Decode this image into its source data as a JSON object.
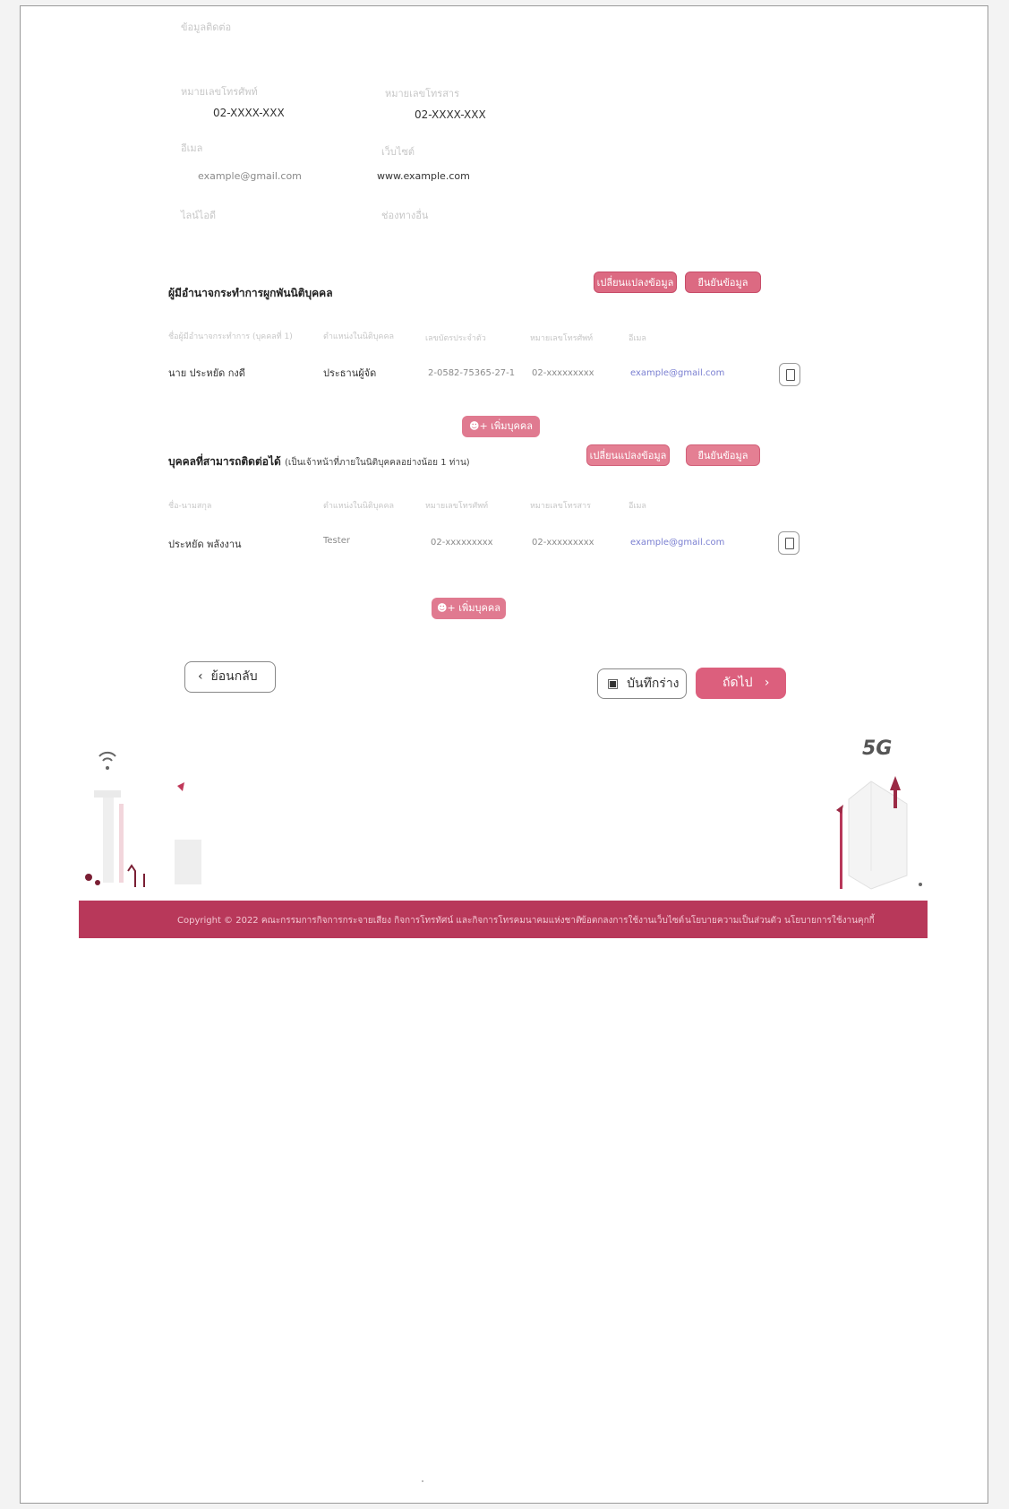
{
  "contact": {
    "top_label": "ข้อมูลติดต่อ",
    "phone_label": "หมายเลขโทรศัพท์",
    "phone_value": "02-XXXX-XXX",
    "fax_label": "หมายเลขโทรสาร",
    "fax_value": "02-XXXX-XXX",
    "email_label": "อีเมล",
    "email_value": "example@gmail.com",
    "website_label": "เว็บไซต์",
    "website_value": "www.example.com",
    "line_label": "ไลน์ไอดี",
    "other_label": "ช่องทางอื่น"
  },
  "authorized": {
    "title": "ผู้มีอำนาจกระทำการผูกพันนิติบุคคล",
    "change_button": "เปลี่ยนแปลงข้อมูล",
    "confirm_button": "ยืนยันข้อมูล",
    "headers": [
      "ชื่อผู้มีอำนาจกระทำการ (บุคคลที่ 1)",
      "ตำแหน่งในนิติบุคคล",
      "เลขบัตรประจำตัว",
      "หมายเลขโทรศัพท์",
      "อีเมล"
    ],
    "row": [
      "นาย ประหยัด กงดี",
      "ประธานผู้จัด",
      "2-0582-75365-27-1",
      "02-xxxxxxxxx",
      "example@gmail.com"
    ],
    "add_button": "เพิ่มบุคคล"
  },
  "contacts": {
    "title": "บุคคลที่สามารถติดต่อได้",
    "note": "(เป็นเจ้าหน้าที่ภายในนิติบุคคลอย่างน้อย 1 ท่าน)",
    "change_button": "เปลี่ยนแปลงข้อมูล",
    "confirm_button": "ยืนยันข้อมูล",
    "headers": [
      "ชื่อ-นามสกุล",
      "ตำแหน่งในนิติบุคคล",
      "หมายเลขโทรศัพท์",
      "หมายเลขโทรสาร",
      "อีเมล"
    ],
    "row": [
      "ประหยัด พลังงาน",
      "Tester",
      "02-xxxxxxxxx",
      "02-xxxxxxxxx",
      "example@gmail.com"
    ],
    "add_button": "เพิ่มบุคคล"
  },
  "nav": {
    "back": "ย้อนกลับ",
    "draft": "บันทึกร่าง",
    "next": "ถัดไป"
  },
  "illustration": {
    "badge": "5G"
  },
  "footer": {
    "copyright": "Copyright © 2022 คณะกรรมการกิจการกระจายเสียง กิจการโทรทัศน์ และกิจการโทรคมนาคมแห่งชาติ",
    "terms": "ข้อตกลงการใช้งานเว็บไซต์",
    "privacy": "นโยบายความเป็นส่วนตัว",
    "cookie": "นโยบายการใช้งานคุกกี้"
  },
  "colors": {
    "accent": "#dc6a82",
    "footer": "#b8385a"
  }
}
